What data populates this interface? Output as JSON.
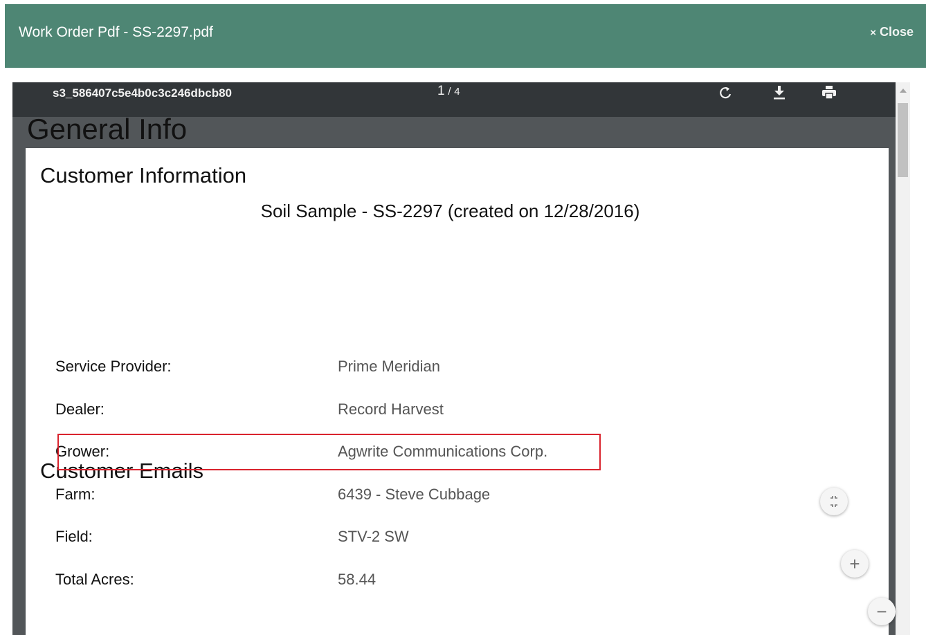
{
  "modal": {
    "title": "Work Order Pdf - SS-2297.pdf",
    "close_icon": "×",
    "close_label": "Close"
  },
  "viewer": {
    "file_name": "s3_586407c5e4b0c3c246dbcb80",
    "page_current": "1",
    "page_separator": "/",
    "page_total": "4",
    "icons": [
      "rotate-icon",
      "download-icon",
      "print-icon"
    ]
  },
  "document": {
    "title": "Soil Sample - SS-2297 (created on 12/28/2016)",
    "section_heading": "General Info",
    "subsection_heading": "Customer Information",
    "fields": [
      {
        "label": "Service Provider:",
        "value": "Prime Meridian"
      },
      {
        "label": "Dealer:",
        "value": "Record Harvest"
      },
      {
        "label": "Grower:",
        "value": "Agwrite Communications Corp."
      },
      {
        "label": "Farm:",
        "value": "6439 - Steve Cubbage"
      },
      {
        "label": "Field:",
        "value": "STV-2 SW"
      },
      {
        "label": "Total Acres:",
        "value": "58.44"
      }
    ],
    "next_subsection_heading": "Customer Emails"
  },
  "highlight": {
    "field": "Grower:",
    "color": "#d9232d"
  },
  "zoom_controls": {
    "fit_icon": "fit-to-page-icon",
    "zoom_in_symbol": "+",
    "zoom_out_symbol": "−"
  },
  "colors": {
    "header_bg": "#4e8674",
    "toolbar_bg": "#323639",
    "viewer_bg": "#525659"
  }
}
